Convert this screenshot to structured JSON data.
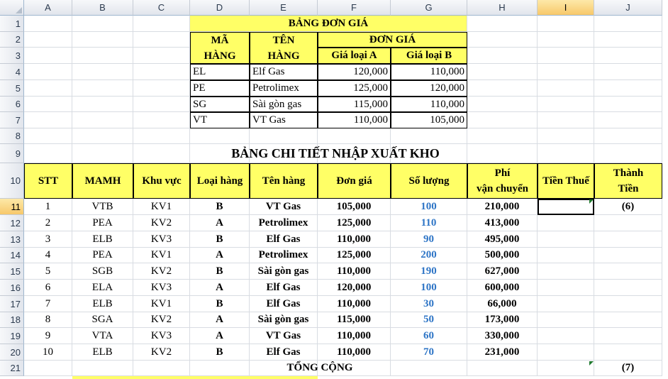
{
  "columns": [
    "A",
    "B",
    "C",
    "D",
    "E",
    "F",
    "G",
    "H",
    "I",
    "J"
  ],
  "rows": [
    "1",
    "2",
    "3",
    "4",
    "5",
    "6",
    "7",
    "8",
    "9",
    "10",
    "11",
    "12",
    "13",
    "14",
    "15",
    "16",
    "17",
    "18",
    "19",
    "20",
    "21"
  ],
  "price_table": {
    "title": "BẢNG ĐƠN GIÁ",
    "h_ma_1": "MÃ",
    "h_ma_2": "HÀNG",
    "h_ten_1": "TÊN",
    "h_ten_2": "HÀNG",
    "h_dongia": "ĐƠN GIÁ",
    "h_a": "Giá loại A",
    "h_b": "Giá loại B",
    "rows": [
      {
        "code": "EL",
        "name": "Elf Gas",
        "a": "120,000",
        "b": "110,000"
      },
      {
        "code": "PE",
        "name": "Petrolimex",
        "a": "125,000",
        "b": "120,000"
      },
      {
        "code": "SG",
        "name": "Sài gòn gas",
        "a": "115,000",
        "b": "110,000"
      },
      {
        "code": "VT",
        "name": "VT Gas",
        "a": "110,000",
        "b": "105,000"
      }
    ]
  },
  "detail_table": {
    "title": "BẢNG CHI TIẾT NHẬP XUẤT KHO",
    "headers": {
      "stt": "STT",
      "mamh": "MAMH",
      "khuvuc": "Khu vực",
      "loai": "Loại hàng",
      "ten": "Tên hàng",
      "dongia": "Đơn giá",
      "soluong": "Số lượng",
      "phi_1": "Phí",
      "phi_2": "vận chuyển",
      "thue": "Tiền Thuế",
      "tt_1": "Thành",
      "tt_2": "Tiền"
    },
    "rows": [
      {
        "stt": "1",
        "mamh": "VTB",
        "kv": "KV1",
        "loai": "B",
        "ten": "VT Gas",
        "dongia": "105,000",
        "sl": "100",
        "phi": "210,000",
        "tt": "(6)"
      },
      {
        "stt": "2",
        "mamh": "PEA",
        "kv": "KV2",
        "loai": "A",
        "ten": "Petrolimex",
        "dongia": "125,000",
        "sl": "110",
        "phi": "413,000",
        "tt": ""
      },
      {
        "stt": "3",
        "mamh": "ELB",
        "kv": "KV3",
        "loai": "B",
        "ten": "Elf Gas",
        "dongia": "110,000",
        "sl": "90",
        "phi": "495,000",
        "tt": ""
      },
      {
        "stt": "4",
        "mamh": "PEA",
        "kv": "KV1",
        "loai": "A",
        "ten": "Petrolimex",
        "dongia": "125,000",
        "sl": "200",
        "phi": "500,000",
        "tt": ""
      },
      {
        "stt": "5",
        "mamh": "SGB",
        "kv": "KV2",
        "loai": "B",
        "ten": "Sài gòn gas",
        "dongia": "110,000",
        "sl": "190",
        "phi": "627,000",
        "tt": ""
      },
      {
        "stt": "6",
        "mamh": "ELA",
        "kv": "KV3",
        "loai": "A",
        "ten": "Elf Gas",
        "dongia": "120,000",
        "sl": "100",
        "phi": "600,000",
        "tt": ""
      },
      {
        "stt": "7",
        "mamh": "ELB",
        "kv": "KV1",
        "loai": "B",
        "ten": "Elf Gas",
        "dongia": "110,000",
        "sl": "30",
        "phi": "66,000",
        "tt": ""
      },
      {
        "stt": "8",
        "mamh": "SGA",
        "kv": "KV2",
        "loai": "A",
        "ten": "Sài gòn gas",
        "dongia": "115,000",
        "sl": "50",
        "phi": "173,000",
        "tt": ""
      },
      {
        "stt": "9",
        "mamh": "VTA",
        "kv": "KV3",
        "loai": "A",
        "ten": "VT Gas",
        "dongia": "110,000",
        "sl": "60",
        "phi": "330,000",
        "tt": ""
      },
      {
        "stt": "10",
        "mamh": "ELB",
        "kv": "KV2",
        "loai": "B",
        "ten": "Elf Gas",
        "dongia": "110,000",
        "sl": "70",
        "phi": "231,000",
        "tt": ""
      }
    ],
    "total_label": "TỔNG CỘNG",
    "total_value": "(7)"
  },
  "colors": {
    "yellow": "#ffff66",
    "blue_qty": "#2e75c6",
    "marker": "#1f7a2e"
  }
}
